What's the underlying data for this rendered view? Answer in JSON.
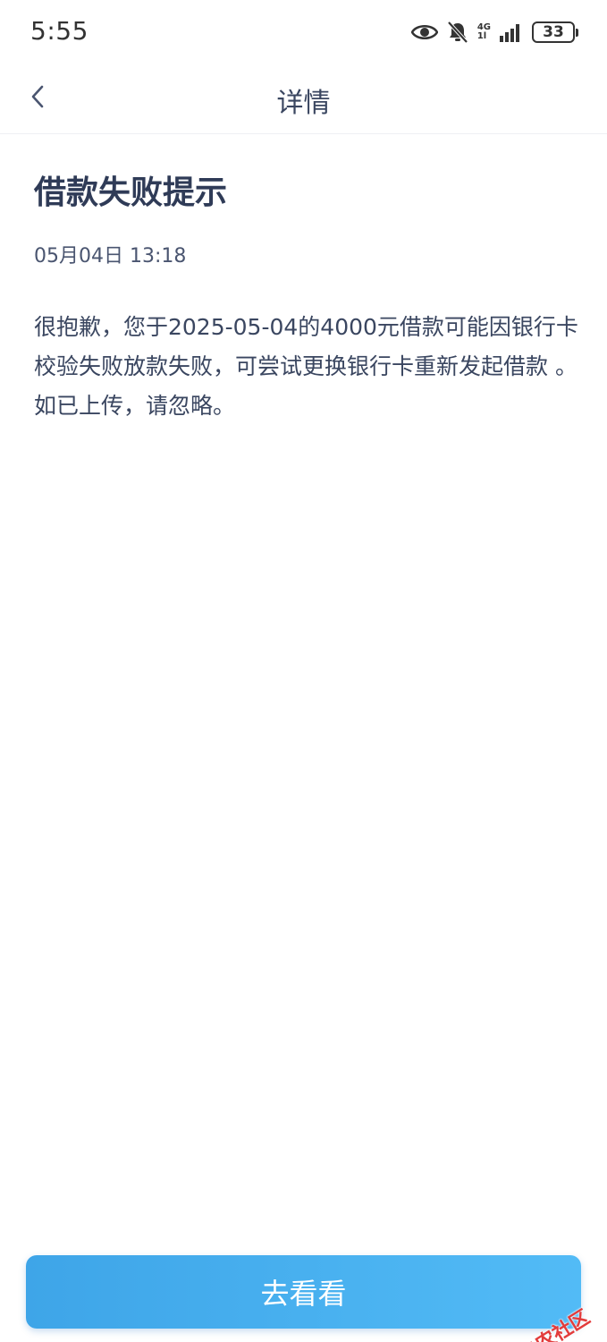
{
  "status_bar": {
    "time": "5:55",
    "network_top": "4G",
    "network_bottom": "1l",
    "battery": "33"
  },
  "nav": {
    "back_icon": "chevron-left-icon",
    "title": "详情"
  },
  "message": {
    "title": "借款失败提示",
    "time": "05月04日 13:18",
    "body": "很抱歉，您于2025-05-04的4000元借款可能因银行卡校验失败放款失败，可尝试更换银行卡重新发起借款 。如已上传，请忽略。"
  },
  "action": {
    "label": "去看看"
  },
  "watermark": {
    "text": "卡农社区"
  },
  "colors": {
    "button_start": "#3ea5e8",
    "button_end": "#52bbf6",
    "title": "#2f3b57",
    "text": "#3a4660"
  }
}
